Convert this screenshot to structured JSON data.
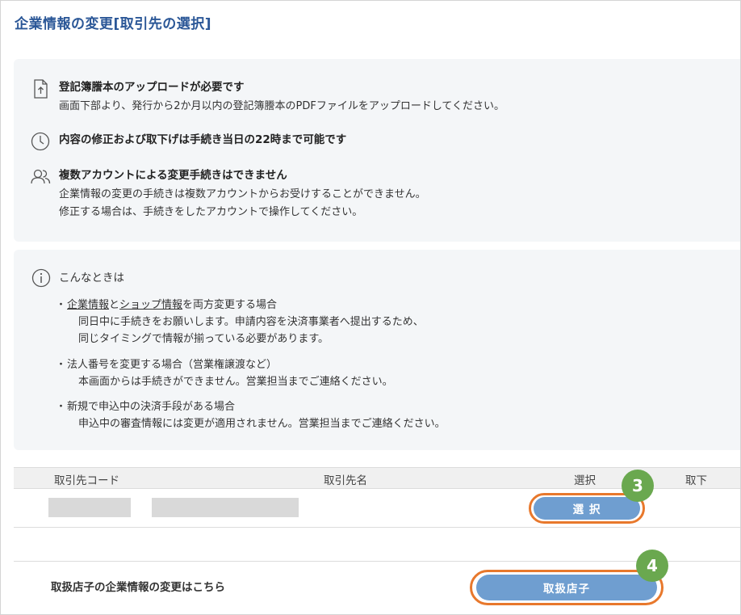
{
  "page": {
    "title": "企業情報の変更[取引先の選択]"
  },
  "notices": [
    {
      "icon": "upload-document-icon",
      "title": "登記簿謄本のアップロードが必要です",
      "lines": [
        "画面下部より、発行から2か月以内の登記簿謄本のPDFファイルをアップロードしてください。"
      ]
    },
    {
      "icon": "clock-icon",
      "title": "内容の修正および取下げは手続き当日の22時まで可能です",
      "lines": []
    },
    {
      "icon": "users-icon",
      "title": "複数アカウントによる変更手続きはできません",
      "lines": [
        "企業情報の変更の手続きは複数アカウントからお受けすることができません。",
        "修正する場合は、手続きをしたアカウントで操作してください。"
      ]
    }
  ],
  "info": {
    "icon": "info-icon",
    "title": "こんなときは",
    "cases": [
      {
        "bullet": "・",
        "link1": "企業情報",
        "mid": "と",
        "link2": "ショップ情報",
        "rest": "を両方変更する場合",
        "lines": [
          "同日中に手続きをお願いします。申請内容を決済事業者へ提出するため、",
          "同じタイミングで情報が揃っている必要があります。"
        ]
      },
      {
        "bullet": "・",
        "text": "法人番号を変更する場合（営業権譲渡など）",
        "lines": [
          "本画面からは手続きができません。営業担当までご連絡ください。"
        ]
      },
      {
        "bullet": "・",
        "text": "新規で申込中の決済手段がある場合",
        "lines": [
          "申込中の審査情報には変更が適用されません。営業担当までご連絡ください。"
        ]
      }
    ]
  },
  "table": {
    "headers": {
      "code": "取引先コード",
      "name": "取引先名",
      "select": "選択",
      "withdraw": "取下"
    },
    "row": {
      "select_button": "選 択"
    }
  },
  "footer": {
    "label": "取扱店子の企業情報の変更はこちら",
    "button": "取扱店子"
  },
  "markers": {
    "step3": "3",
    "step4": "4"
  },
  "colors": {
    "title": "#2b5797",
    "button": "#6f9ed0",
    "highlight_ring": "#e8782c",
    "marker": "#6aa84f"
  }
}
